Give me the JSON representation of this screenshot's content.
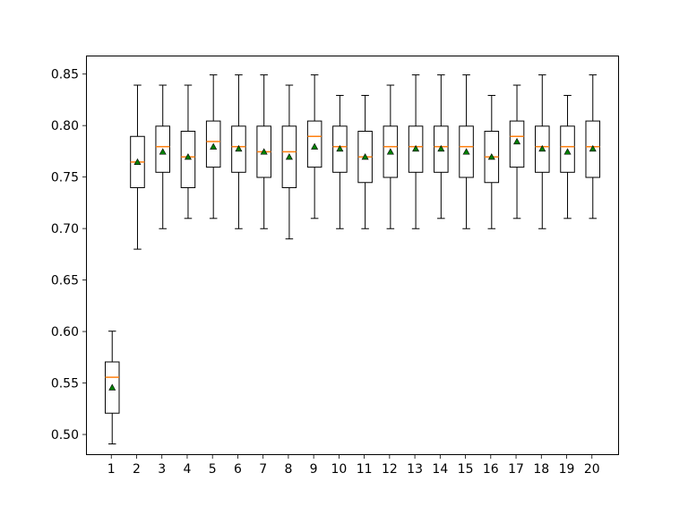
{
  "chart_data": {
    "type": "boxplot",
    "categories": [
      "1",
      "2",
      "3",
      "4",
      "5",
      "6",
      "7",
      "8",
      "9",
      "10",
      "11",
      "12",
      "13",
      "14",
      "15",
      "16",
      "17",
      "18",
      "19",
      "20"
    ],
    "y_ticks": [
      0.5,
      0.55,
      0.6,
      0.65,
      0.7,
      0.75,
      0.8,
      0.85
    ],
    "y_tick_labels": [
      "0.50",
      "0.55",
      "0.60",
      "0.65",
      "0.70",
      "0.75",
      "0.80",
      "0.85"
    ],
    "ylim": [
      0.48,
      0.868
    ],
    "xlabel": "",
    "ylabel": "",
    "title": "",
    "series": [
      {
        "q1": 0.52,
        "median": 0.555,
        "q3": 0.57,
        "whisker_low": 0.49,
        "whisker_high": 0.6,
        "mean": 0.545
      },
      {
        "q1": 0.74,
        "median": 0.765,
        "q3": 0.79,
        "whisker_low": 0.68,
        "whisker_high": 0.84,
        "mean": 0.765
      },
      {
        "q1": 0.755,
        "median": 0.78,
        "q3": 0.8,
        "whisker_low": 0.7,
        "whisker_high": 0.84,
        "mean": 0.775
      },
      {
        "q1": 0.74,
        "median": 0.77,
        "q3": 0.795,
        "whisker_low": 0.71,
        "whisker_high": 0.84,
        "mean": 0.77
      },
      {
        "q1": 0.76,
        "median": 0.785,
        "q3": 0.805,
        "whisker_low": 0.71,
        "whisker_high": 0.85,
        "mean": 0.78
      },
      {
        "q1": 0.755,
        "median": 0.78,
        "q3": 0.8,
        "whisker_low": 0.7,
        "whisker_high": 0.85,
        "mean": 0.778
      },
      {
        "q1": 0.75,
        "median": 0.775,
        "q3": 0.8,
        "whisker_low": 0.7,
        "whisker_high": 0.85,
        "mean": 0.775
      },
      {
        "q1": 0.74,
        "median": 0.775,
        "q3": 0.8,
        "whisker_low": 0.69,
        "whisker_high": 0.84,
        "mean": 0.77
      },
      {
        "q1": 0.76,
        "median": 0.79,
        "q3": 0.805,
        "whisker_low": 0.71,
        "whisker_high": 0.85,
        "mean": 0.78
      },
      {
        "q1": 0.755,
        "median": 0.78,
        "q3": 0.8,
        "whisker_low": 0.7,
        "whisker_high": 0.83,
        "mean": 0.778
      },
      {
        "q1": 0.745,
        "median": 0.77,
        "q3": 0.795,
        "whisker_low": 0.7,
        "whisker_high": 0.83,
        "mean": 0.77
      },
      {
        "q1": 0.75,
        "median": 0.78,
        "q3": 0.8,
        "whisker_low": 0.7,
        "whisker_high": 0.84,
        "mean": 0.775
      },
      {
        "q1": 0.755,
        "median": 0.78,
        "q3": 0.8,
        "whisker_low": 0.7,
        "whisker_high": 0.85,
        "mean": 0.778
      },
      {
        "q1": 0.755,
        "median": 0.78,
        "q3": 0.8,
        "whisker_low": 0.71,
        "whisker_high": 0.85,
        "mean": 0.778
      },
      {
        "q1": 0.75,
        "median": 0.78,
        "q3": 0.8,
        "whisker_low": 0.7,
        "whisker_high": 0.85,
        "mean": 0.775
      },
      {
        "q1": 0.745,
        "median": 0.77,
        "q3": 0.795,
        "whisker_low": 0.7,
        "whisker_high": 0.83,
        "mean": 0.77
      },
      {
        "q1": 0.76,
        "median": 0.79,
        "q3": 0.805,
        "whisker_low": 0.71,
        "whisker_high": 0.84,
        "mean": 0.785
      },
      {
        "q1": 0.755,
        "median": 0.78,
        "q3": 0.8,
        "whisker_low": 0.7,
        "whisker_high": 0.85,
        "mean": 0.778
      },
      {
        "q1": 0.755,
        "median": 0.78,
        "q3": 0.8,
        "whisker_low": 0.71,
        "whisker_high": 0.83,
        "mean": 0.775
      },
      {
        "q1": 0.75,
        "median": 0.78,
        "q3": 0.805,
        "whisker_low": 0.71,
        "whisker_high": 0.85,
        "mean": 0.778
      }
    ],
    "box_style": {
      "box_line": "#000000",
      "box_fill": "none",
      "median_color": "#ff7f0e",
      "whisker_color": "#000000",
      "cap_color": "#000000",
      "mean_marker": "triangle",
      "mean_fill": "#008000",
      "mean_edge": "#000000"
    }
  }
}
